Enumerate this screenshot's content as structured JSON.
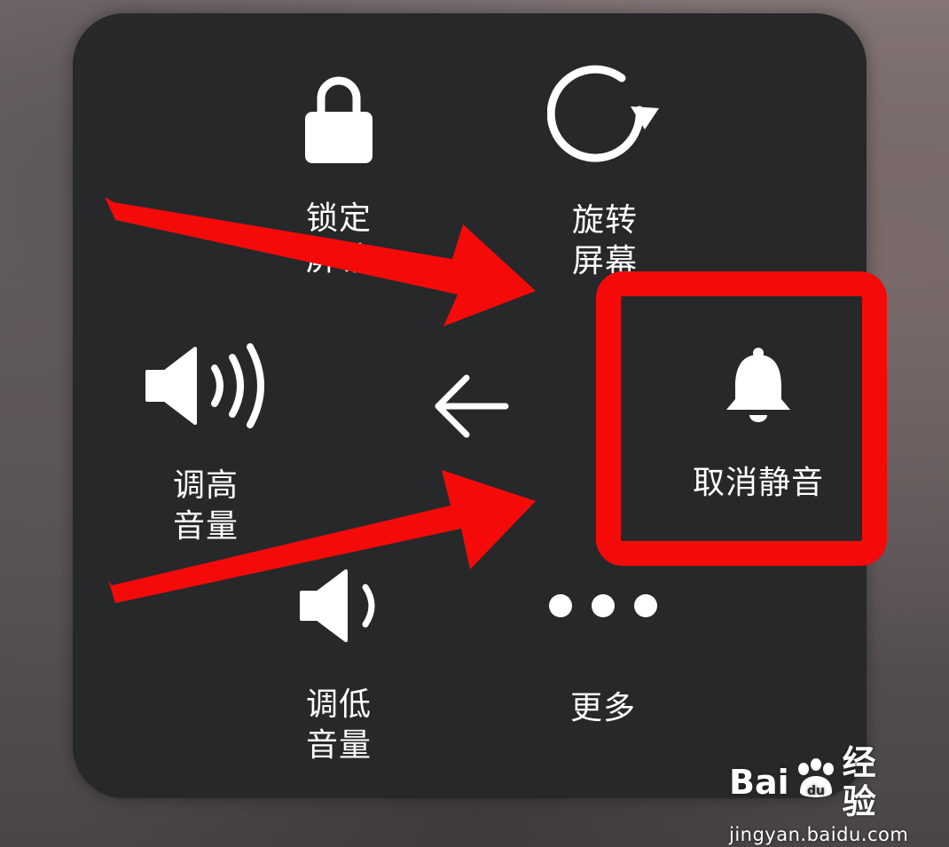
{
  "menu": {
    "lock_screen": {
      "label": "锁定屏幕",
      "icon": "lock-icon"
    },
    "rotate_screen": {
      "label": "旋转屏幕",
      "icon": "rotate-icon"
    },
    "volume_up": {
      "label": "调高音量",
      "icon": "volume-up-icon"
    },
    "back": {
      "icon": "back-arrow-icon"
    },
    "unmute": {
      "label": "取消静音",
      "icon": "bell-icon"
    },
    "volume_down": {
      "label": "调低音量",
      "icon": "volume-down-icon"
    },
    "more": {
      "label": "更多",
      "icon": "more-dots-icon"
    }
  },
  "annotations": {
    "highlight_color": "#f50a0a",
    "arrow_color": "#f50a0a"
  },
  "watermark": {
    "brand_left": "Bai",
    "brand_right": "经验",
    "url": "jingyan.baidu.com"
  },
  "colors": {
    "panel_bg": "#26282a",
    "icon_color": "#ffffff"
  }
}
